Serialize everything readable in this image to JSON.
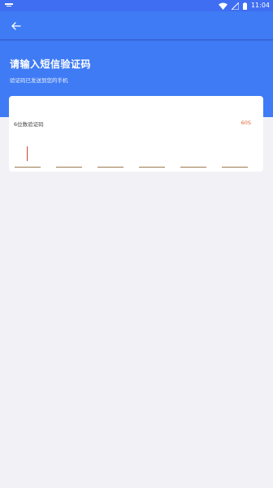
{
  "status_bar": {
    "time": "11:04",
    "left_icon": "notification-icon",
    "icons": [
      "wifi-icon",
      "signal-icon",
      "battery-icon"
    ]
  },
  "header": {
    "back_icon": "arrow-left-icon",
    "title": "请输入短信验证码",
    "subtitle": "验证码已发送到您的手机"
  },
  "card": {
    "label": "6位数验证码",
    "countdown": "60S",
    "code_slots": [
      "",
      "",
      "",
      "",
      "",
      ""
    ],
    "active_slot": 0
  },
  "colors": {
    "primary": "#3f7bf4",
    "countdown": "#e06a3a",
    "background": "#f1f1f6"
  }
}
